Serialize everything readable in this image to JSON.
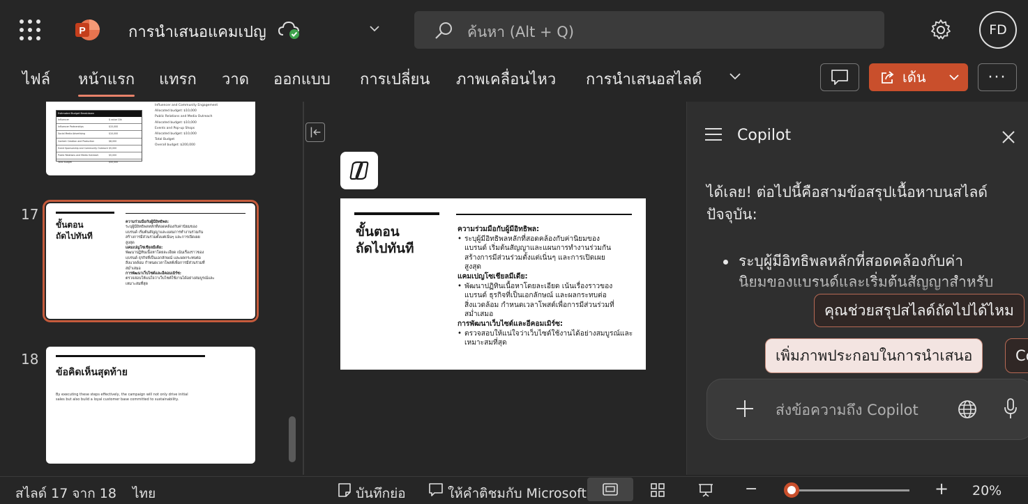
{
  "app": {
    "document_title": "การนำเสนอแคมเปญ",
    "search_placeholder": "ค้นหา (Alt + Q)",
    "user_initials": "FD",
    "accent_color": "#c94f2c"
  },
  "ribbon": {
    "tabs": [
      "ไฟล์",
      "หน้าแรก",
      "แทรก",
      "วาด",
      "ออกแบบ",
      "การเปลี่ยน",
      "ภาพเคลื่อนไหว",
      "การนำเสนอสไลด์"
    ],
    "active_tab": "หน้าแรก",
    "share_label": "เด้น",
    "more_label": "···"
  },
  "thumbnails": {
    "slide16": {
      "table_header": "Estimated Budget Breakdown",
      "rows": [
        [
          "Influencer",
          "$ value 10k"
        ],
        [
          "Influencer Partnerships",
          "$15,000"
        ],
        [
          "Social Media Advertising",
          "$10,000"
        ],
        [
          "Content Creation and Production",
          "$8,000"
        ],
        [
          "Event Sponsorship and Community Outreach",
          "$5,000"
        ],
        [
          "Public Relations and Media Outreach",
          "$5,000"
        ],
        [
          "Total Budget",
          "$50,000"
        ]
      ],
      "bullets": [
        "Influencer and Community Engagement",
        "Allocated budget: $10,000",
        "Public Relations and Media Outreach",
        "Allocated budget: $10,000",
        "Events and Pop-up Shops",
        "Allocated budget: $10,000",
        "Total Budget",
        "Overall budget: $200,000"
      ]
    },
    "slide17": {
      "number": "17",
      "title_line1": "ขั้นตอน",
      "title_line2": "ถัดไปทันที",
      "h1": "ความร่วมมือกับผู้มีอิทธิพล:",
      "b1": [
        "ระบุผู้มีอิทธิพลหลักที่สอดคล้องกับค่านิยมของ",
        "แบรนด์ เริ่มต้นสัญญาและแผนการทำงานร่วมกัน",
        "สร้างการมีส่วนร่วมตั้งแต่เนิ่นๆ และการเปิดเผย",
        "สูงสุด"
      ],
      "h2": "แคมเปญโซเชียลมีเดีย:",
      "b2": [
        "พัฒนาปฏิทินเนื้อหาโดยละเอียด เน้นเรื่องราวของ",
        "แบรนด์ ธุรกิจที่เป็นเอกลักษณ์ และผลกระทบต่อ",
        "สิ่งแวดล้อม กำหนดเวลาโพสต์เพื่อการมีส่วนร่วมที่",
        "สม่ำเสมอ"
      ],
      "h3": "การพัฒนาเว็บไซต์และอีคอมเมิร์ซ:",
      "b3": [
        "ตรวจสอบให้แน่ใจว่าเว็บไซต์ใช้งานได้อย่างสมบูรณ์และ",
        "เหมาะสมที่สุด"
      ]
    },
    "slide18": {
      "number": "18",
      "title": "ข้อคิดเห็นสุดท้าย",
      "body_line1": "By executing these steps effectively, the campaign will not only drive initial",
      "body_line2": "sales but also build a loyal customer base committed to sustainability."
    }
  },
  "main_slide": {
    "title_line1": "ขั้นตอน",
    "title_line2": "ถัดไปทันที",
    "h1": "ความร่วมมือกับผู้มีอิทธิพล:",
    "b1": [
      "ระบุผู้มีอิทธิพลหลักที่สอดคล้องกับค่านิยมของ",
      "แบรนด์ เริ่มต้นสัญญาและแผนการทำงานร่วมกัน",
      "สร้างการมีส่วนร่วมตั้งแต่เนิ่นๆ และการเปิดเผย",
      "สูงสุด"
    ],
    "h2": "แคมเปญโซเชียลมีเดีย:",
    "b2": [
      "พัฒนาปฏิทินเนื้อหาโดยละเอียด เน้นเรื่องราวของ",
      "แบรนด์ ธุรกิจที่เป็นเอกลักษณ์ และผลกระทบต่อ",
      "สิ่งแวดล้อม กำหนดเวลาโพสต์เพื่อการมีส่วนร่วมที่",
      "สม่ำเสมอ"
    ],
    "h3": "การพัฒนาเว็บไซต์และอีคอมเมิร์ซ:",
    "b3": [
      "ตรวจสอบให้แน่ใจว่าเว็บไซต์ใช้งานได้อย่างสมบูรณ์และ",
      "เหมาะสมที่สุด"
    ]
  },
  "copilot": {
    "title": "Copilot",
    "message": "ได้เลย! ต่อไปนี้คือสามข้อสรุปเนื้อหาบนสไลด์ปัจจุบัน:",
    "bullet_line1": "ระบุผู้มีอิทธิพลหลักที่สอดคล้องกับค่า",
    "bullet_line2": "นิยมของแบรนด์และเริ่มต้นสัญญาสำหรับ",
    "suggestion_1": "คุณช่วยสรุปสไลด์ถัดไปได้ไหม",
    "suggestion_2": "เพิ่มภาพประกอบในการนำเสนอ",
    "suggestion_3": "Co",
    "input_placeholder": "ส่งข้อความถึง Copilot"
  },
  "status": {
    "slide_position": "สไลด์ 17 จาก 18",
    "language": "ไทย",
    "notes_label": "บันทึกย่อ",
    "feedback_label": "ให้คำติชมกับ Microsoft",
    "zoom_minus": "−",
    "zoom_plus": "+",
    "zoom_percent": "20%"
  }
}
